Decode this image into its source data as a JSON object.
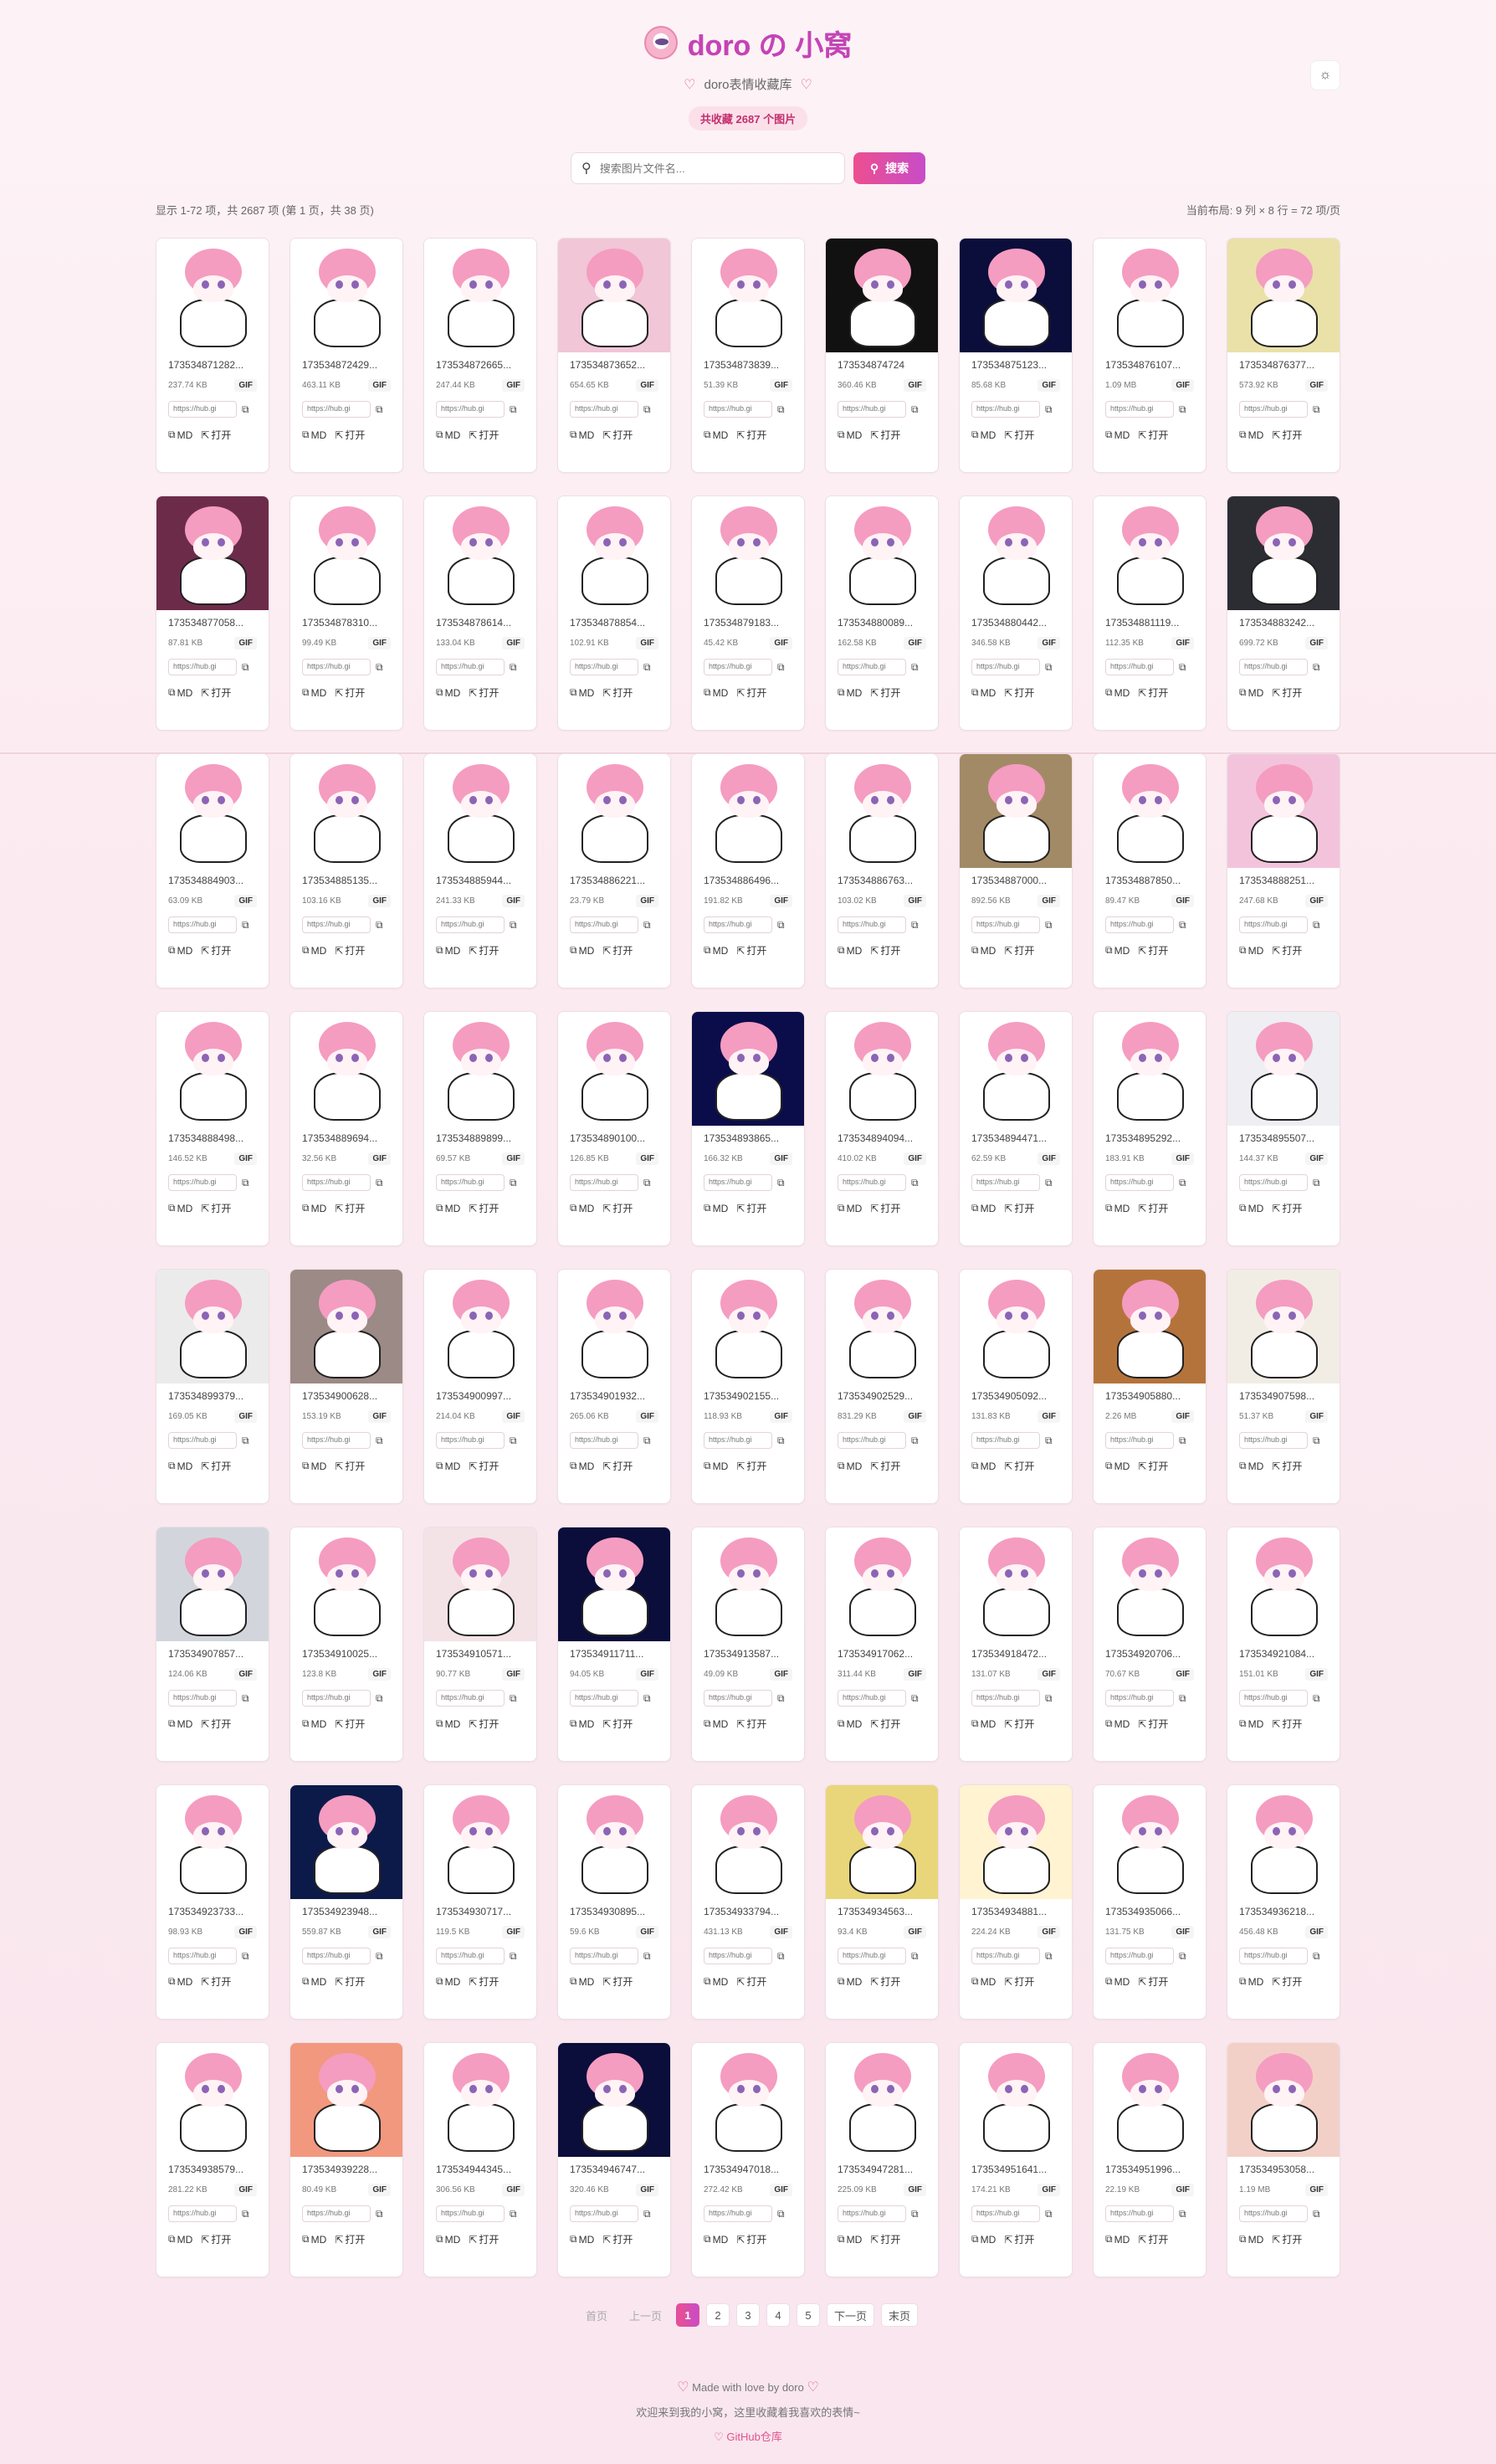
{
  "header": {
    "title": "doro の 小窝",
    "subtitle": "doro表情收藏库",
    "count_badge": "共收藏 2687 个图片",
    "theme_icon": "sun-icon"
  },
  "search": {
    "placeholder": "搜索图片文件名...",
    "button_label": "搜索"
  },
  "meta": {
    "showing": "显示 1-72 项，共 2687 项 (第 1 页，共 38 页)",
    "layout": "当前布局: 9 列 × 8 行 = 72 项/页"
  },
  "card_labels": {
    "type": "GIF",
    "url": "https://hub.gi",
    "md": "MD",
    "open": "打开"
  },
  "images": [
    {
      "name": "173534871282...",
      "size": "237.74 KB"
    },
    {
      "name": "173534872429...",
      "size": "463.11 KB"
    },
    {
      "name": "173534872665...",
      "size": "247.44 KB"
    },
    {
      "name": "173534873652...",
      "size": "654.65 KB"
    },
    {
      "name": "173534873839...",
      "size": "51.39 KB"
    },
    {
      "name": "173534874724",
      "size": "360.46 KB"
    },
    {
      "name": "173534875123...",
      "size": "85.68 KB"
    },
    {
      "name": "173534876107...",
      "size": "1.09 MB"
    },
    {
      "name": "173534876377...",
      "size": "573.92 KB"
    },
    {
      "name": "173534877058...",
      "size": "87.81 KB"
    },
    {
      "name": "173534878310...",
      "size": "99.49 KB"
    },
    {
      "name": "173534878614...",
      "size": "133.04 KB"
    },
    {
      "name": "173534878854...",
      "size": "102.91 KB"
    },
    {
      "name": "173534879183...",
      "size": "45.42 KB"
    },
    {
      "name": "173534880089...",
      "size": "162.58 KB"
    },
    {
      "name": "173534880442...",
      "size": "346.58 KB"
    },
    {
      "name": "173534881119...",
      "size": "112.35 KB"
    },
    {
      "name": "173534883242...",
      "size": "699.72 KB"
    },
    {
      "name": "173534884903...",
      "size": "63.09 KB"
    },
    {
      "name": "173534885135...",
      "size": "103.16 KB"
    },
    {
      "name": "173534885944...",
      "size": "241.33 KB"
    },
    {
      "name": "173534886221...",
      "size": "23.79 KB"
    },
    {
      "name": "173534886496...",
      "size": "191.82 KB"
    },
    {
      "name": "173534886763...",
      "size": "103.02 KB"
    },
    {
      "name": "173534887000...",
      "size": "892.56 KB"
    },
    {
      "name": "173534887850...",
      "size": "89.47 KB"
    },
    {
      "name": "173534888251...",
      "size": "247.68 KB"
    },
    {
      "name": "173534888498...",
      "size": "146.52 KB"
    },
    {
      "name": "173534889694...",
      "size": "32.56 KB"
    },
    {
      "name": "173534889899...",
      "size": "69.57 KB"
    },
    {
      "name": "173534890100...",
      "size": "126.85 KB"
    },
    {
      "name": "173534893865...",
      "size": "166.32 KB"
    },
    {
      "name": "173534894094...",
      "size": "410.02 KB"
    },
    {
      "name": "173534894471...",
      "size": "62.59 KB"
    },
    {
      "name": "173534895292...",
      "size": "183.91 KB"
    },
    {
      "name": "173534895507...",
      "size": "144.37 KB"
    },
    {
      "name": "173534899379...",
      "size": "169.05 KB"
    },
    {
      "name": "173534900628...",
      "size": "153.19 KB"
    },
    {
      "name": "173534900997...",
      "size": "214.04 KB"
    },
    {
      "name": "173534901932...",
      "size": "265.06 KB"
    },
    {
      "name": "173534902155...",
      "size": "118.93 KB"
    },
    {
      "name": "173534902529...",
      "size": "831.29 KB"
    },
    {
      "name": "173534905092...",
      "size": "131.83 KB"
    },
    {
      "name": "173534905880...",
      "size": "2.26 MB"
    },
    {
      "name": "173534907598...",
      "size": "51.37 KB"
    },
    {
      "name": "173534907857...",
      "size": "124.06 KB"
    },
    {
      "name": "173534910025...",
      "size": "123.8 KB"
    },
    {
      "name": "173534910571...",
      "size": "90.77 KB"
    },
    {
      "name": "173534911711...",
      "size": "94.05 KB"
    },
    {
      "name": "173534913587...",
      "size": "49.09 KB"
    },
    {
      "name": "173534917062...",
      "size": "311.44 KB"
    },
    {
      "name": "173534918472...",
      "size": "131.07 KB"
    },
    {
      "name": "173534920706...",
      "size": "70.67 KB"
    },
    {
      "name": "173534921084...",
      "size": "151.01 KB"
    },
    {
      "name": "173534923733...",
      "size": "98.93 KB"
    },
    {
      "name": "173534923948...",
      "size": "559.87 KB"
    },
    {
      "name": "173534930717...",
      "size": "119.5 KB"
    },
    {
      "name": "173534930895...",
      "size": "59.6 KB"
    },
    {
      "name": "173534933794...",
      "size": "431.13 KB"
    },
    {
      "name": "173534934563...",
      "size": "93.4 KB"
    },
    {
      "name": "173534934881...",
      "size": "224.24 KB"
    },
    {
      "name": "173534935066...",
      "size": "131.75 KB"
    },
    {
      "name": "173534936218...",
      "size": "456.48 KB"
    },
    {
      "name": "173534938579...",
      "size": "281.22 KB"
    },
    {
      "name": "173534939228...",
      "size": "80.49 KB"
    },
    {
      "name": "173534944345...",
      "size": "306.56 KB"
    },
    {
      "name": "173534946747...",
      "size": "320.46 KB"
    },
    {
      "name": "173534947018...",
      "size": "272.42 KB"
    },
    {
      "name": "173534947281...",
      "size": "225.09 KB"
    },
    {
      "name": "173534951641...",
      "size": "174.21 KB"
    },
    {
      "name": "173534951996...",
      "size": "22.19 KB"
    },
    {
      "name": "173534953058...",
      "size": "1.19 MB"
    }
  ],
  "thumb_backgrounds": [
    "#ffffff",
    "#ffffff",
    "#ffffff",
    "#f1c6d6",
    "#ffffff",
    "#111111",
    "#0b0d3a",
    "#ffffff",
    "#e9e1a8",
    "#6d2b4a",
    "#ffffff",
    "#ffffff",
    "#ffffff",
    "#ffffff",
    "#ffffff",
    "#ffffff",
    "#ffffff",
    "#2c2d33",
    "#ffffff",
    "#ffffff",
    "#ffffff",
    "#ffffff",
    "#ffffff",
    "#ffffff",
    "#a38a66",
    "#ffffff",
    "#f3c3dc",
    "#ffffff",
    "#ffffff",
    "#ffffff",
    "#ffffff",
    "#0b0d4a",
    "#ffffff",
    "#ffffff",
    "#ffffff",
    "#eeeef3",
    "#ebebeb",
    "#9c8a86",
    "#ffffff",
    "#ffffff",
    "#ffffff",
    "#ffffff",
    "#ffffff",
    "#b5733c",
    "#f1ede5",
    "#d2d6dc",
    "#ffffff",
    "#f4e3e6",
    "#0b0d3a",
    "#ffffff",
    "#ffffff",
    "#ffffff",
    "#ffffff",
    "#ffffff",
    "#ffffff",
    "#0c1a4a",
    "#ffffff",
    "#ffffff",
    "#ffffff",
    "#e9d67a",
    "#fff3d1",
    "#ffffff",
    "#ffffff",
    "#ffffff",
    "#f2987e",
    "#ffffff",
    "#0b0d3a",
    "#ffffff",
    "#ffffff",
    "#ffffff",
    "#ffffff",
    "#f3d0c7"
  ],
  "pagination": {
    "first": "首页",
    "prev": "上一页",
    "pages": [
      "1",
      "2",
      "3",
      "4",
      "5"
    ],
    "next": "下一页",
    "last": "末页"
  },
  "footer": {
    "made_with": "Made with love by doro",
    "welcome": "欢迎来到我的小窝，这里收藏着我喜欢的表情~",
    "github": "GitHub仓库"
  }
}
